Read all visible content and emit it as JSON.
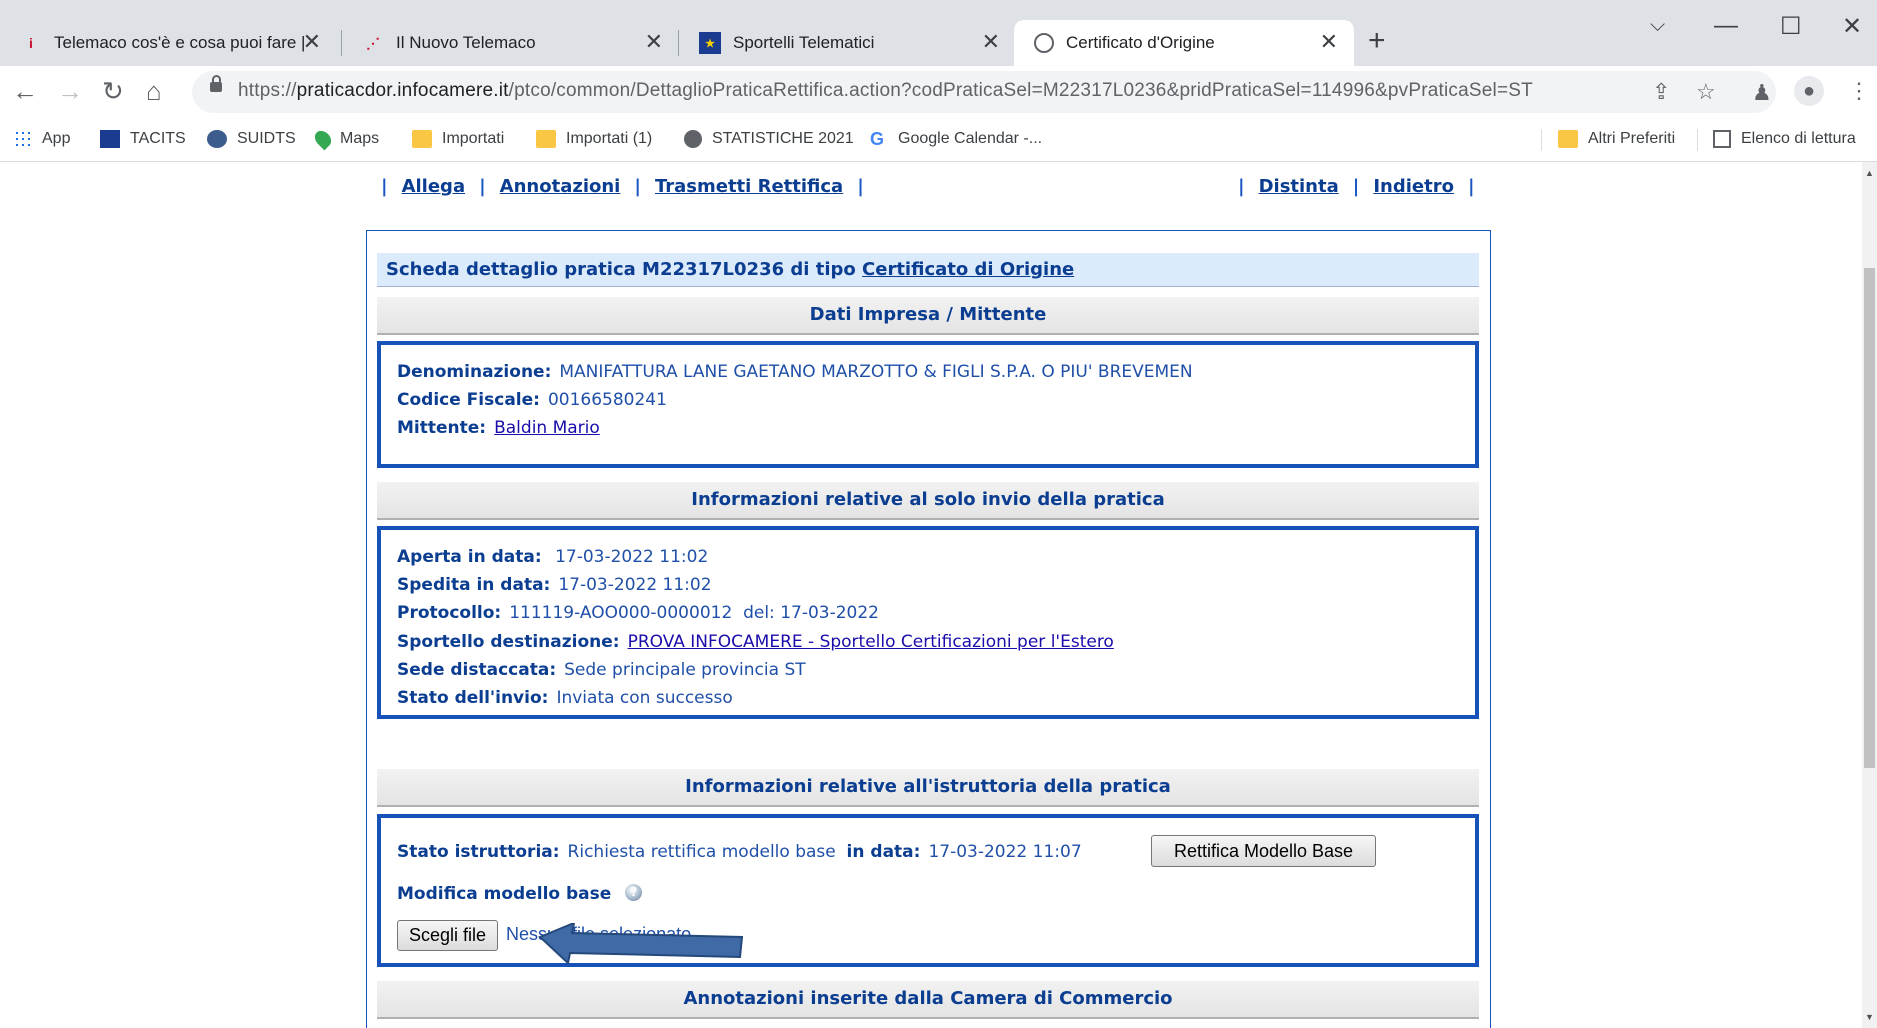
{
  "browser": {
    "tabs": [
      {
        "title": "Telemaco cos'è e cosa puoi fare |",
        "active": false
      },
      {
        "title": "Il Nuovo Telemaco",
        "active": false
      },
      {
        "title": "Sportelli Telematici",
        "active": false
      },
      {
        "title": "Certificato d'Origine",
        "active": true
      }
    ],
    "url_host": "praticacdor.infocamere.it",
    "url_prefix": "https://",
    "url_path": "/ptco/common/DettaglioPraticaRettifica.action?codPraticaSel=M22317L0236&pridPraticaSel=114996&pvPraticaSel=ST",
    "bookmarks": {
      "app": "App",
      "tacits": "TACITS",
      "suidts": "SUIDTS",
      "maps": "Maps",
      "importati": "Importati",
      "importati1": "Importati (1)",
      "statistiche": "STATISTICHE 2021",
      "calendar": "Google Calendar -...",
      "altri": "Altri Preferiti",
      "elenco": "Elenco di lettura"
    }
  },
  "nav": {
    "allega": "Allega",
    "annotazioni": "Annotazioni",
    "trasmetti": "Trasmetti Rettifica",
    "distinta": "Distinta",
    "indietro": "Indietro"
  },
  "header": {
    "prefix": "Scheda dettaglio pratica M22317L0236 di tipo",
    "tipo": "Certificato di Origine"
  },
  "impresa": {
    "title": "Dati Impresa / Mittente",
    "denominazione_label": "Denominazione:",
    "denominazione": "MANIFATTURA LANE GAETANO MARZOTTO & FIGLI S.P.A. O PIU' BREVEMEN",
    "cf_label": "Codice Fiscale:",
    "cf": "00166580241",
    "mittente_label": "Mittente:",
    "mittente": "Baldin Mario"
  },
  "invio": {
    "title": "Informazioni relative al solo invio della pratica",
    "aperta_label": "Aperta in data:",
    "aperta": "17-03-2022 11:02",
    "spedita_label": "Spedita in data:",
    "spedita": "17-03-2022 11:02",
    "protocollo_label": "Protocollo:",
    "protocollo": "111119-AOO000-0000012",
    "del_label": "del:",
    "del": "17-03-2022",
    "sportello_label": "Sportello destinazione:",
    "sportello": "PROVA INFOCAMERE - Sportello Certificazioni per l'Estero",
    "sede_label": "Sede distaccata:",
    "sede": "Sede principale provincia ST",
    "stato_label": "Stato dell'invio:",
    "stato": "Inviata con successo"
  },
  "istruttoria": {
    "title": "Informazioni relative all'istruttoria della pratica",
    "stato_label": "Stato istruttoria:",
    "stato": "Richiesta rettifica modello base",
    "data_label": "in data:",
    "data": "17-03-2022 11:07",
    "rettifica_button": "Rettifica Modello Base",
    "modifica_label": "Modifica modello base",
    "file_button": "Scegli file",
    "file_status": "Nessun file selezionato"
  },
  "annotazioni": {
    "title": "Annotazioni inserite dalla Camera di Commercio"
  },
  "colors": {
    "label_blue": "#0b3d91",
    "box_border": "#1652b8",
    "arrow": "#3f6aa6"
  }
}
